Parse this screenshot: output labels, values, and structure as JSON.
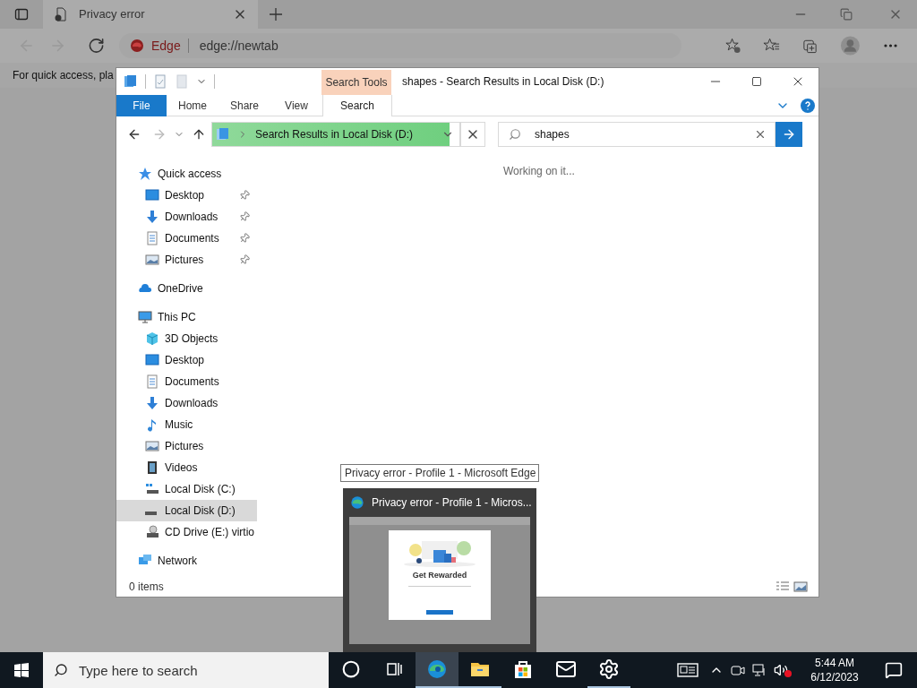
{
  "browser": {
    "tabs": [
      {
        "title": "Privacy error",
        "selected": true
      }
    ],
    "address": {
      "brand": "Edge",
      "url": "edge://newtab"
    },
    "favorites_bar_text": "For quick access, pla"
  },
  "explorer": {
    "title": "shapes - Search Results in Local Disk (D:)",
    "context_label": "Search Tools",
    "ribbon_tabs": [
      {
        "label": "File",
        "kind": "file"
      },
      {
        "label": "Home",
        "kind": "tab"
      },
      {
        "label": "Share",
        "kind": "tab"
      },
      {
        "label": "View",
        "kind": "tab"
      },
      {
        "label": "Search",
        "kind": "contextual"
      }
    ],
    "address": {
      "path": "Search Results in Local Disk (D:)",
      "level": 0.96
    },
    "search": {
      "value": "shapes"
    },
    "content_status": "Working on it...",
    "nav": [
      {
        "label": "Quick access",
        "kind": "quick",
        "selected": false,
        "children": [
          {
            "label": "Desktop",
            "kind": "desktop",
            "selected": false,
            "pinned": true
          },
          {
            "label": "Downloads",
            "kind": "downloads",
            "selected": false,
            "pinned": true
          },
          {
            "label": "Documents",
            "kind": "documents",
            "selected": false,
            "pinned": true
          },
          {
            "label": "Pictures",
            "kind": "pictures",
            "selected": false,
            "pinned": true
          }
        ]
      },
      {
        "label": "OneDrive",
        "kind": "cloud",
        "selected": false
      },
      {
        "label": "This PC",
        "kind": "pc",
        "selected": false,
        "children": [
          {
            "label": "3D Objects",
            "kind": "cube",
            "selected": false
          },
          {
            "label": "Desktop",
            "kind": "desktop",
            "selected": false
          },
          {
            "label": "Documents",
            "kind": "documents",
            "selected": false
          },
          {
            "label": "Downloads",
            "kind": "downloads",
            "selected": false
          },
          {
            "label": "Music",
            "kind": "music",
            "selected": false
          },
          {
            "label": "Pictures",
            "kind": "pictures",
            "selected": false
          },
          {
            "label": "Videos",
            "kind": "videos",
            "selected": false
          },
          {
            "label": "Local Disk (C:)",
            "kind": "system_drive",
            "selected": false
          },
          {
            "label": "Local Disk (D:)",
            "kind": "drive",
            "selected": true
          },
          {
            "label": "CD Drive (E:) virtio",
            "kind": "cd",
            "selected": false
          }
        ]
      },
      {
        "label": "Network",
        "kind": "network",
        "selected": false
      }
    ],
    "status_bar": "0 items"
  },
  "preview": {
    "tooltip": "Privacy error - Profile 1 - Microsoft Edge",
    "title": "Privacy error - Profile 1 - Micros...",
    "dialog_title": "Get Rewarded"
  },
  "taskbar": {
    "search_placeholder": "Type here to search",
    "apps": [
      {
        "kind": "cortana",
        "selected": false,
        "running": false
      },
      {
        "kind": "taskview",
        "selected": false,
        "running": false
      },
      {
        "kind": "edge",
        "selected": true,
        "running": true
      },
      {
        "kind": "explorer",
        "selected": false,
        "running": true
      },
      {
        "kind": "store",
        "selected": false,
        "running": false
      },
      {
        "kind": "mail",
        "selected": false,
        "running": false
      },
      {
        "kind": "settings",
        "selected": false,
        "running": true
      }
    ],
    "time": "5:44 AM",
    "date": "6/12/2023"
  }
}
